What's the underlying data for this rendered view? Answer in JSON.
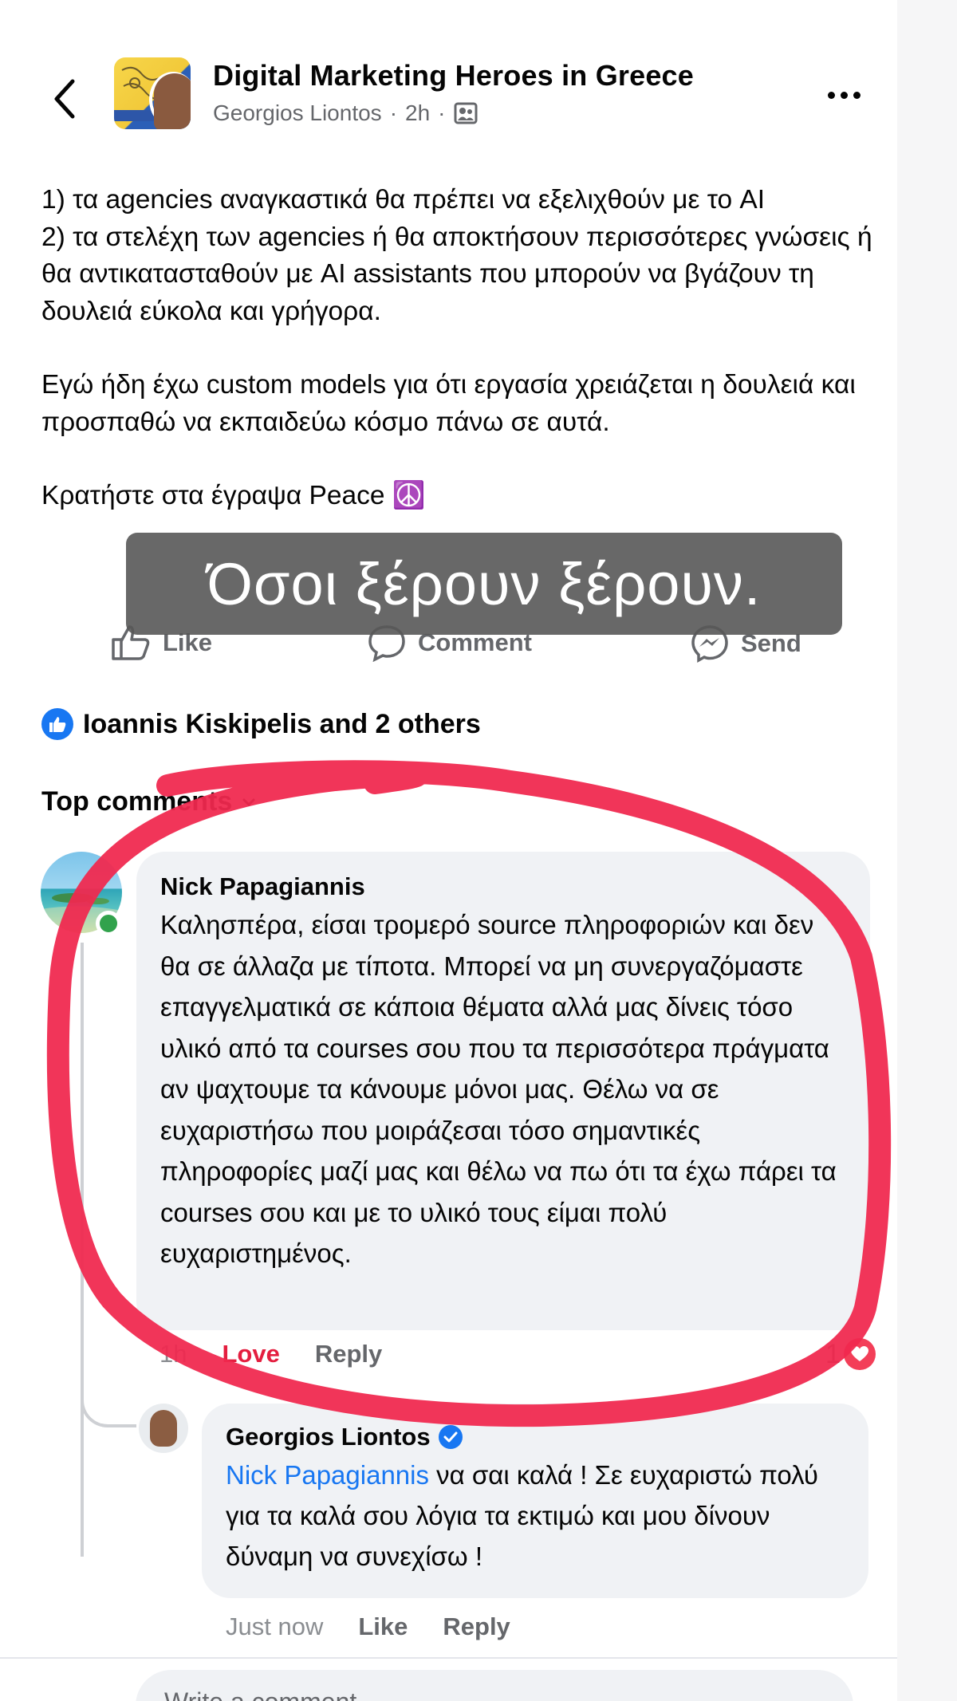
{
  "header": {
    "group_name": "Digital Marketing Heroes in Greece",
    "author": "Georgios Liontos",
    "separator": "·",
    "time": "2h",
    "privacy_icon": "group-members-icon"
  },
  "post": {
    "line1": "1) τα agencies αναγκαστικά θα πρέπει να εξελιχθούν με το AI",
    "line2": "2) τα στελέχη των agencies ή θα αποκτήσουν περισσότερες γνώσεις ή θα αντικατασταθούν με AI assistants που μπορούν να βγάζουν τη δουλειά εύκολα και γρήγορα.",
    "line3": "Εγώ ήδη έχω custom models για ότι εργασία χρειάζεται η δουλειά και προσπαθώ να εκπαιδεύω κόσμο πάνω σε αυτά.",
    "line4": "Κρατήστε στα έγραψα Peace ☮️"
  },
  "overlay": {
    "caption": "Όσοι ξέρουν ξέρουν."
  },
  "actions": {
    "like": "Like",
    "comment": "Comment",
    "send": "Send"
  },
  "reactions": {
    "summary": "Ioannis Kiskipelis and 2 others"
  },
  "comments_header": {
    "label": "Top comments"
  },
  "comment1": {
    "author": "Nick Papagiannis",
    "text": "Καλησπέρα, είσαι τρομερό source πληροφοριών και δεν θα σε άλλαζα με τίποτα. Μπορεί να μη συνεργαζόμαστε επαγγελματικά σε κάποια θέματα αλλά μας δίνεις τόσο υλικό από τα courses σου που τα περισσότερα πράγματα αν ψαχτουμε τα κάνουμε μόνοι μας. Θέλω να σε ευχαριστήσω που μοιράζεσαι τόσο σημαντικές πληροφορίες μαζί μας και θέλω να πω ότι τα έχω πάρει τα courses σου και με το υλικό τους είμαι πολύ ευχαριστημένος.",
    "time": "1h",
    "love": "Love",
    "reply": "Reply",
    "reaction_count": "1"
  },
  "reply1": {
    "author": "Georgios Liontos",
    "mention": "Nick Papagiannis",
    "text": " να σαι καλά ! Σε ευχαριστώ πολύ για τα καλά σου λόγια τα εκτιμώ και μου δίνουν δύναμη να συνεχίσω !",
    "time": "Just now",
    "like": "Like",
    "reply": "Reply"
  },
  "composer": {
    "placeholder": "Write a comment..."
  },
  "colors": {
    "brand_blue": "#1877f2",
    "love_red": "#e41e3f",
    "marker_red": "#f0284f",
    "bubble_bg": "#f0f2f5"
  }
}
